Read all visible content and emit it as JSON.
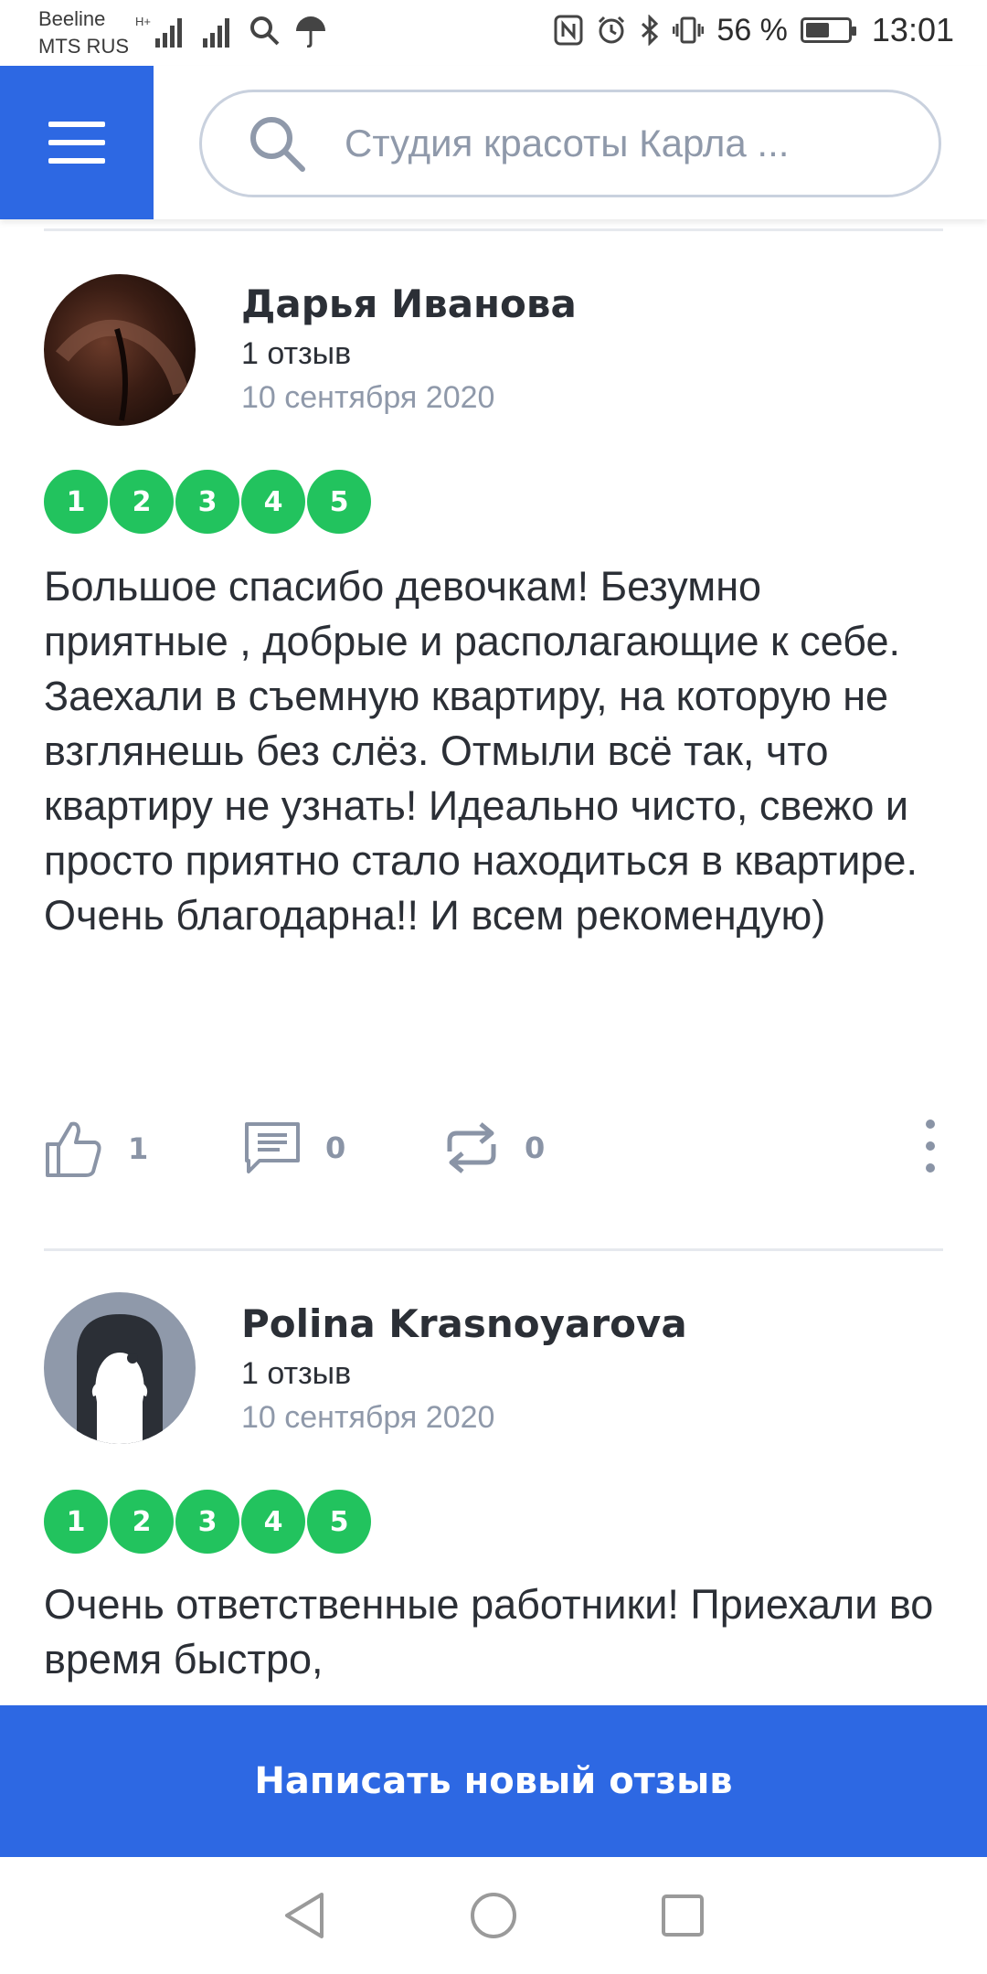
{
  "status_bar": {
    "carrier1": "Beeline",
    "carrier2": "MTS RUS",
    "battery_pct": "56 %",
    "battery_level": 0.56,
    "time": "13:01"
  },
  "header": {
    "search_placeholder": "Студия красоты Карла ..."
  },
  "reviews": [
    {
      "author": "Дарья Иванова",
      "count": "1 отзыв",
      "date": "10 сентября 2020",
      "ratings": [
        "1",
        "2",
        "3",
        "4",
        "5"
      ],
      "text": "Большое спасибо девочкам! Безумно приятные , добрые и располагающие к себе. Заехали в съемную квартиру, на которую не взглянешь без слёз. Отмыли всё так, что квартиру не узнать! Идеально чисто, свежо и просто приятно стало находиться в квартире. Очень благодарна!! И всем рекомендую)",
      "likes": "1",
      "comments": "0",
      "reposts": "0"
    },
    {
      "author": "Polina Krasnoyarova",
      "count": "1 отзыв",
      "date": "10 сентября 2020",
      "ratings": [
        "1",
        "2",
        "3",
        "4",
        "5"
      ],
      "text": "Очень ответственные работники! Приехали во время быстро,"
    }
  ],
  "cta": {
    "label": "Написать новый отзыв"
  },
  "colors": {
    "accent": "#2d68e3",
    "rating": "#22c35e",
    "muted": "#8f99aa"
  }
}
